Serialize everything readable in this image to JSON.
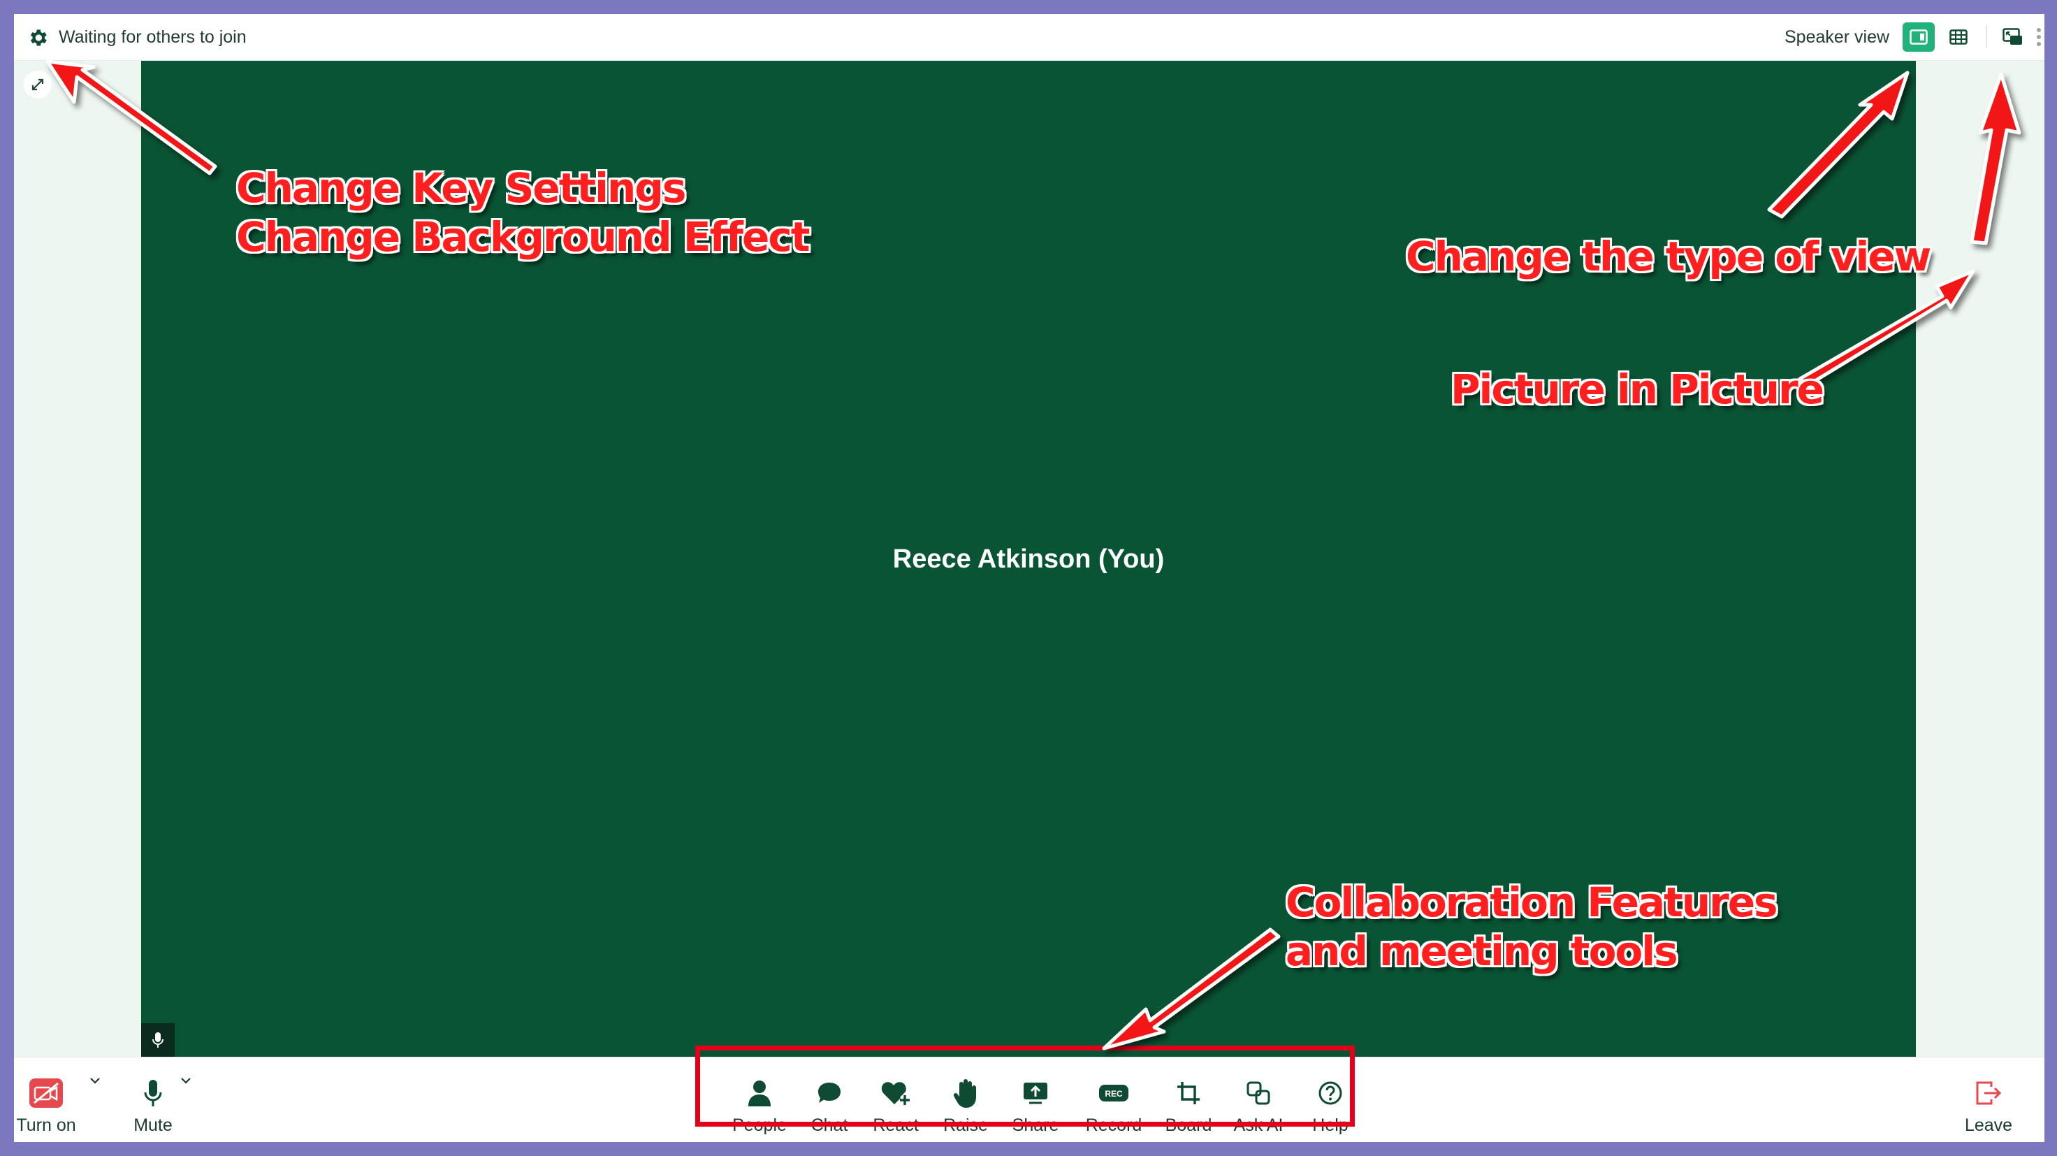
{
  "topbar": {
    "status": "Waiting for others to join",
    "view_label": "Speaker view"
  },
  "stage": {
    "participant_name": "Reece Atkinson (You)"
  },
  "bottombar": {
    "left": [
      {
        "label": "Turn on",
        "icon": "camera-off-icon"
      },
      {
        "label": "Mute",
        "icon": "microphone-icon"
      }
    ],
    "tools": [
      {
        "label": "People",
        "icon": "person-icon"
      },
      {
        "label": "Chat",
        "icon": "chat-bubble-icon"
      },
      {
        "label": "React",
        "icon": "heart-plus-icon"
      },
      {
        "label": "Raise",
        "icon": "raised-hand-icon"
      },
      {
        "label": "Share",
        "icon": "screen-share-icon"
      },
      {
        "label": "Record",
        "icon": "rec-icon"
      },
      {
        "label": "Board",
        "icon": "crop-board-icon"
      },
      {
        "label": "Ask AI",
        "icon": "ai-shapes-icon"
      },
      {
        "label": "Help",
        "icon": "help-circle-icon"
      }
    ],
    "record_badge": "REC",
    "leave_label": "Leave"
  },
  "annotations": {
    "settings_line1": "Change Key Settings",
    "settings_line2": "Change Background Effect",
    "view_type": "Change the type of view",
    "pip": "Picture in Picture",
    "collab_line1": "Collaboration Features",
    "collab_line2": "and meeting tools"
  },
  "colors": {
    "frame": "#7b78c0",
    "tile": "#095434",
    "accent": "#20b27a",
    "camera_off": "#e5484d",
    "leave": "#e5484d",
    "annotation": "#ff1f1f"
  }
}
